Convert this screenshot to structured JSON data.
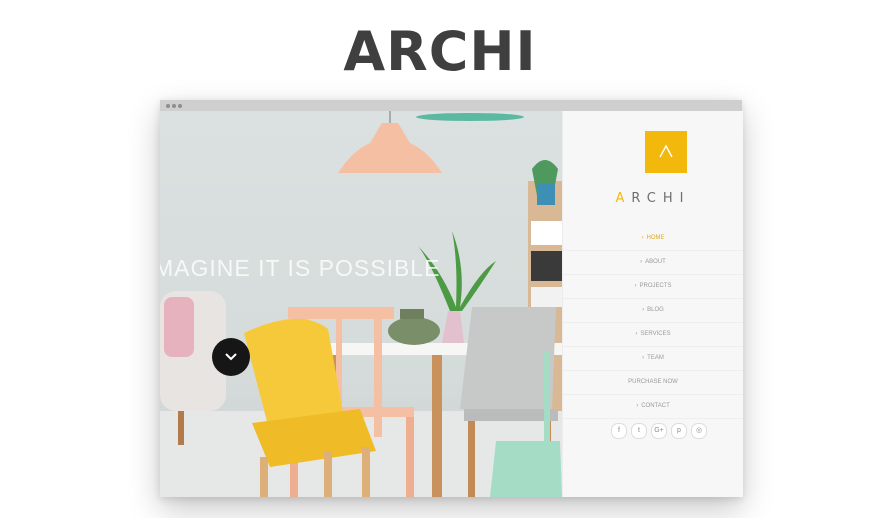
{
  "page": {
    "title": "ARCHI"
  },
  "hero": {
    "tagline": "MAGINE IT IS POSSIBLE"
  },
  "sidebar": {
    "logo_glyph": "Λ",
    "brand_accent": "A",
    "brand_rest": "RCHI",
    "menu": [
      {
        "label": "HOME",
        "active": true
      },
      {
        "label": "ABOUT",
        "active": false
      },
      {
        "label": "PROJECTS",
        "active": false
      },
      {
        "label": "BLOG",
        "active": false
      },
      {
        "label": "SERVICES",
        "active": false
      },
      {
        "label": "TEAM",
        "active": false
      },
      {
        "label": "PURCHASE NOW",
        "active": false
      },
      {
        "label": "CONTACT",
        "active": false
      }
    ],
    "social_icons": [
      {
        "name": "facebook-icon",
        "glyph": "f"
      },
      {
        "name": "twitter-icon",
        "glyph": "t"
      },
      {
        "name": "google-plus-icon",
        "glyph": "G+"
      },
      {
        "name": "pinterest-icon",
        "glyph": "p"
      },
      {
        "name": "instagram-icon",
        "glyph": "◎"
      }
    ]
  },
  "colors": {
    "accent": "#f2b80c",
    "title": "#3f3f3f",
    "sidebar_bg": "#f7f7f7"
  }
}
